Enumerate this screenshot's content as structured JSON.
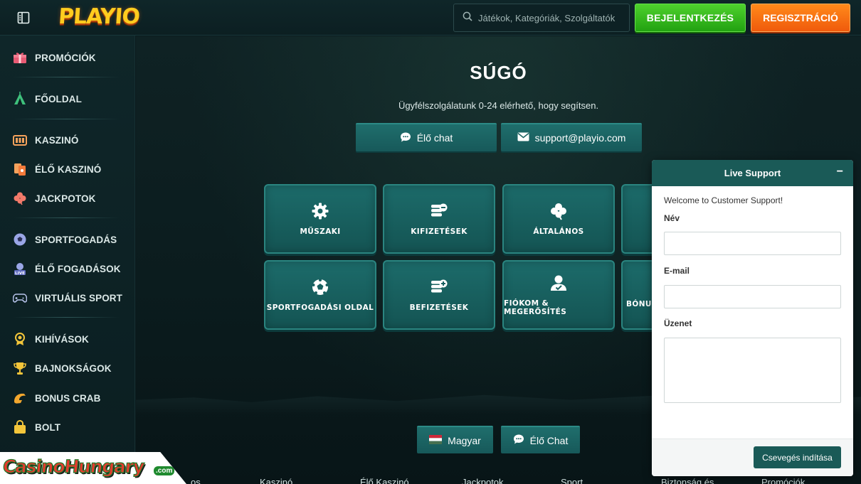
{
  "header": {
    "logo_text": "PLAYIO",
    "search_placeholder": "Játékok, Kategóriák, Szolgáltatók",
    "login_label": "BEJELENTKEZÉS",
    "register_label": "REGISZTRÁCIÓ"
  },
  "sidebar": {
    "items": [
      {
        "label": "PROMÓCIÓK",
        "icon": "gift-icon"
      },
      {
        "label": "FŐOLDAL",
        "icon": "tent-icon"
      },
      {
        "label": "KASZINÓ",
        "icon": "slot-machine-icon"
      },
      {
        "label": "ÉLŐ KASZINÓ",
        "icon": "cards-icon"
      },
      {
        "label": "JACKPOTOK",
        "icon": "clover-icon"
      },
      {
        "label": "SPORTFOGADÁS",
        "icon": "football-icon"
      },
      {
        "label": "ÉLŐ FOGADÁSOK",
        "icon": "live-icon"
      },
      {
        "label": "VIRTUÁLIS SPORT",
        "icon": "gamepad-icon"
      },
      {
        "label": "KIHÍVÁSOK",
        "icon": "medal-icon"
      },
      {
        "label": "BAJNOKSÁGOK",
        "icon": "trophy-icon"
      },
      {
        "label": "BONUS CRAB",
        "icon": "claw-icon"
      },
      {
        "label": "BOLT",
        "icon": "shopping-bag-icon"
      }
    ]
  },
  "main": {
    "title": "SÚGÓ",
    "subtitle": "Ügyfélszolgálatunk 0-24 elérhető, hogy segítsen.",
    "chat_button": "Élő chat",
    "email_button": "support@playio.com",
    "tiles": [
      {
        "label": "MŰSZAKI",
        "icon": "gear-icon"
      },
      {
        "label": "KIFIZETÉSEK",
        "icon": "coins-minus-icon"
      },
      {
        "label": "ÁLTALÁNOS",
        "icon": "clover-icon"
      },
      {
        "label": "",
        "icon": ""
      },
      {
        "label": "SPORTFOGADÁSI OLDAL",
        "icon": "football-icon"
      },
      {
        "label": "BEFIZETÉSEK",
        "icon": "coins-plus-icon"
      },
      {
        "label": "FIÓKOM & MEGERŐSÍTÉS",
        "icon": "user-check-icon"
      },
      {
        "label": "BÓNUS",
        "icon": ""
      }
    ]
  },
  "footer": {
    "language_button": "Magyar",
    "live_chat_button": "Élő Chat",
    "links": [
      "…os",
      "Kaszinó",
      "Élő Kaszinó",
      "Jackpotok",
      "Sport",
      "Biztonság és",
      "Promóciók"
    ]
  },
  "watermark": {
    "text": "CasinoHungary",
    "suffix": ".com"
  },
  "live_support": {
    "title": "Live Support",
    "minimize": "−",
    "welcome": "Welcome to Customer Support!",
    "name_label": "Név",
    "email_label": "E-mail",
    "message_label": "Üzenet",
    "start_button": "Csevegés indítása"
  },
  "colors": {
    "teal": "#1a5a57",
    "green": "#22a111",
    "orange": "#f05a0c",
    "gold": "#ffcc1f"
  }
}
